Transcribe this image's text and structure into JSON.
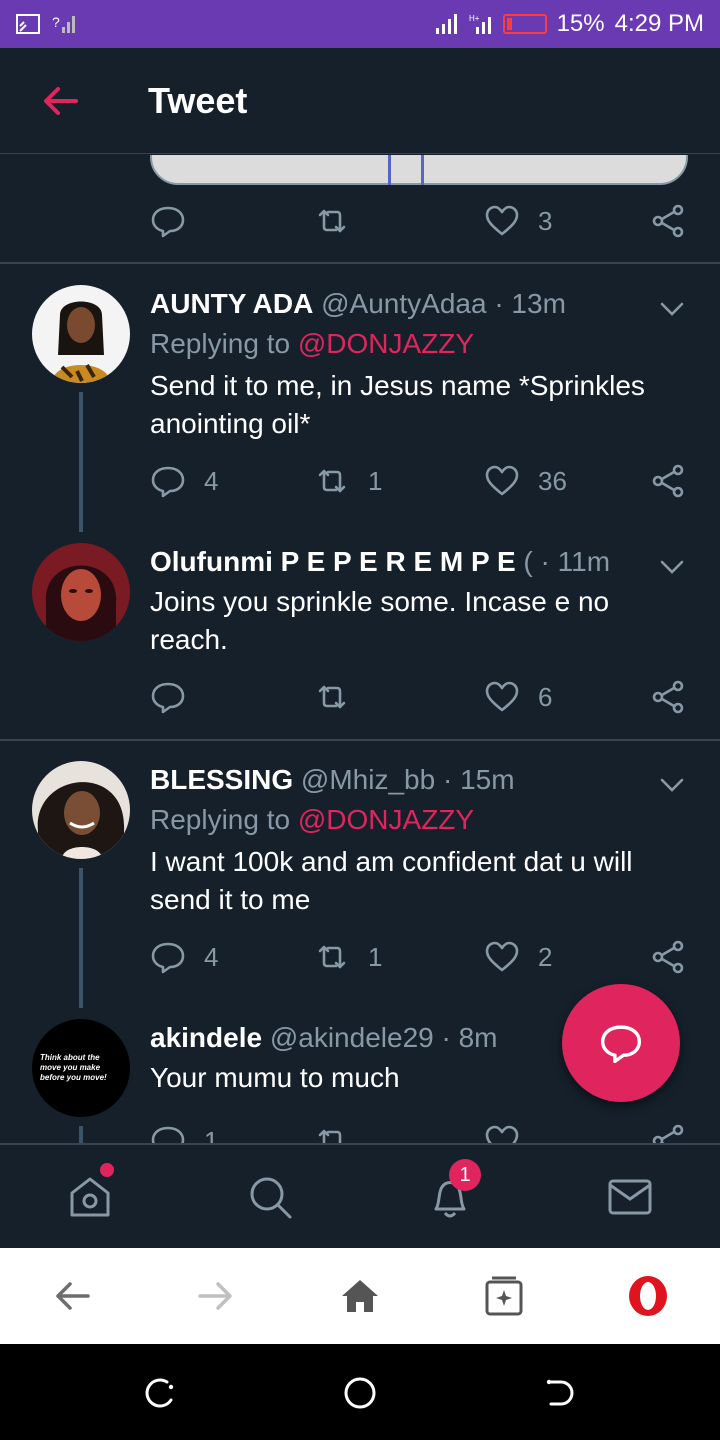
{
  "status_bar": {
    "battery_text": "15%",
    "time": "4:29 PM"
  },
  "app_bar": {
    "title": "Tweet"
  },
  "top_tweet_actions": {
    "likes": "3"
  },
  "tweets": [
    {
      "name": "AUNTY ADA",
      "handle": "@AuntyAdaa",
      "time": "· 13m",
      "reply_prefix": "Replying to",
      "reply_mention": "@DONJAZZY",
      "text": "Send it to me, in Jesus name *Sprinkles anointing oil*",
      "replies": "4",
      "retweets": "1",
      "likes": "36"
    },
    {
      "name": "Olufunmi P E P E R E M P E",
      "handle": "(",
      "time": "· 11m",
      "text": "Joins you sprinkle some. Incase e no reach.",
      "replies": "",
      "retweets": "",
      "likes": "6"
    },
    {
      "name": "BLESSING",
      "handle": "@Mhiz_bb",
      "time": "· 15m",
      "reply_prefix": "Replying to",
      "reply_mention": "@DONJAZZY",
      "text": "I want 100k and am confident dat u will send it to me",
      "replies": "4",
      "retweets": "1",
      "likes": "2"
    },
    {
      "name": "akindele",
      "handle": "@akindele29",
      "time": "· 8m",
      "text": "Your mumu to much",
      "replies": "1",
      "retweets": "",
      "likes": "",
      "avatar_text": "Think about the move you make before you move!"
    }
  ],
  "bottom_nav": {
    "notification_badge": "1"
  },
  "colors": {
    "background": "#15202b",
    "accent": "#e0245e",
    "muted": "#8899a6",
    "status_bar": "#6a3ab2"
  }
}
